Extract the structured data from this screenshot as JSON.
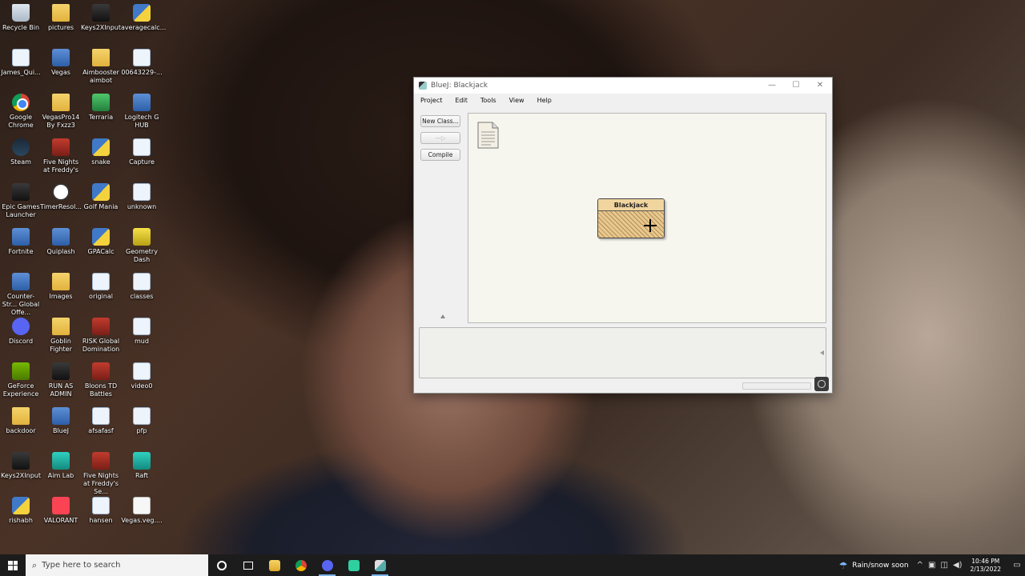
{
  "desktop": {
    "col1": [
      {
        "label": "Recycle Bin",
        "icon": "recycle-bin-icon"
      },
      {
        "label": "James_Qui...",
        "icon": "file-icon"
      },
      {
        "label": "Google Chrome",
        "icon": "chrome-icon"
      },
      {
        "label": "Steam",
        "icon": "steam-icon"
      },
      {
        "label": "Epic Games Launcher",
        "icon": "epic-games-icon"
      },
      {
        "label": "Fortnite",
        "icon": "fortnite-icon"
      },
      {
        "label": "Counter-Str... Global Offe...",
        "icon": "csgo-icon"
      },
      {
        "label": "Discord",
        "icon": "discord-icon"
      },
      {
        "label": "GeForce Experience",
        "icon": "nvidia-icon"
      },
      {
        "label": "backdoor",
        "icon": "folder-icon"
      },
      {
        "label": "Keys2XInput",
        "icon": "gamepad-icon"
      },
      {
        "label": "rishabh",
        "icon": "python-file-icon"
      }
    ],
    "col2": [
      {
        "label": "pictures",
        "icon": "folder-icon"
      },
      {
        "label": "Vegas",
        "icon": "vegas-icon"
      },
      {
        "label": "VegasPro14 By Fxzz3",
        "icon": "folder-icon"
      },
      {
        "label": "Five Nights at Freddy's",
        "icon": "fnaf-icon"
      },
      {
        "label": "TimerResol...",
        "icon": "clock-icon"
      },
      {
        "label": "Quiplash",
        "icon": "quiplash-icon"
      },
      {
        "label": "Images",
        "icon": "folder-icon"
      },
      {
        "label": "Goblin Fighter",
        "icon": "folder-icon"
      },
      {
        "label": "RUN AS ADMIN",
        "icon": "shortcut-icon"
      },
      {
        "label": "BlueJ",
        "icon": "bluej-icon"
      },
      {
        "label": "Aim Lab",
        "icon": "aimlab-icon"
      },
      {
        "label": "VALORANT",
        "icon": "valorant-icon"
      }
    ],
    "col3": [
      {
        "label": "Keys2XInput",
        "icon": "gamepad-icon"
      },
      {
        "label": "Aimbooster aimbot",
        "icon": "folder-icon"
      },
      {
        "label": "Terraria",
        "icon": "terraria-icon"
      },
      {
        "label": "snake",
        "icon": "python-file-icon"
      },
      {
        "label": "Golf Mania",
        "icon": "python-file-icon"
      },
      {
        "label": "GPACalc",
        "icon": "python-file-icon"
      },
      {
        "label": "original",
        "icon": "file-icon"
      },
      {
        "label": "RISK Global Domination",
        "icon": "risk-icon"
      },
      {
        "label": "Bloons TD Battles",
        "icon": "bloons-icon"
      },
      {
        "label": "afsafasf",
        "icon": "file-icon"
      },
      {
        "label": "Five Nights at Freddy's Se...",
        "icon": "fnaf-icon"
      },
      {
        "label": "hansen",
        "icon": "file-icon"
      }
    ],
    "col4": [
      {
        "label": "averagecalc...",
        "icon": "python-file-icon"
      },
      {
        "label": "00643229-...",
        "icon": "file-icon"
      },
      {
        "label": "Logitech G HUB",
        "icon": "logitech-icon"
      },
      {
        "label": "Capture",
        "icon": "file-icon"
      },
      {
        "label": "unknown",
        "icon": "file-icon"
      },
      {
        "label": "Geometry Dash",
        "icon": "geometry-dash-icon"
      },
      {
        "label": "classes",
        "icon": "file-icon"
      },
      {
        "label": "mud",
        "icon": "file-icon"
      },
      {
        "label": "video0",
        "icon": "file-icon"
      },
      {
        "label": "pfp",
        "icon": "file-icon"
      },
      {
        "label": "Raft",
        "icon": "raft-icon"
      },
      {
        "label": "Vegas.veg....",
        "icon": "blank-file-icon"
      }
    ]
  },
  "window": {
    "title": "BlueJ: Blackjack",
    "minimize": "—",
    "maximize": "☐",
    "close": "✕",
    "menus": [
      "Project",
      "Edit",
      "Tools",
      "View",
      "Help"
    ],
    "buttons": {
      "new_class": "New Class...",
      "arrow": "—▷",
      "compile": "Compile"
    },
    "class_name": "Blackjack"
  },
  "taskbar": {
    "search_placeholder": "Type here to search",
    "weather": "Rain/snow soon",
    "time": "10:46 PM",
    "date": "2/13/2022"
  }
}
